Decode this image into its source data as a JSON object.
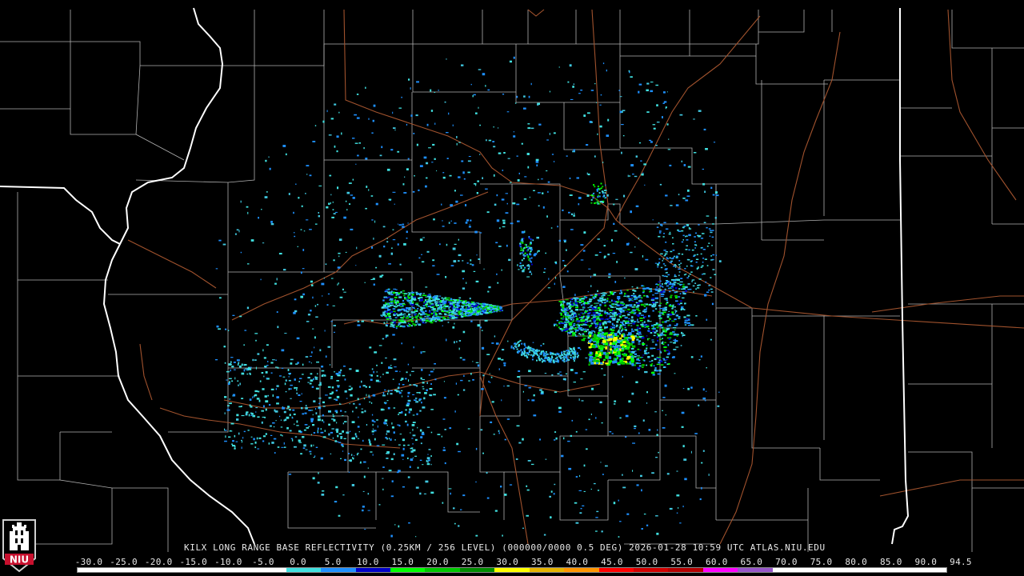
{
  "caption": "KILX LONG RANGE BASE REFLECTIVITY (0.25KM / 256 LEVEL) (000000/0000 0.5 DEG) 2026-01-28 10:59 UTC  ATLAS.NIU.EDU",
  "scale_labels": [
    "-30.0",
    "-25.0",
    "-20.0",
    "-15.0",
    "-10.0",
    "-5.0",
    "0.0",
    "5.0",
    "10.0",
    "15.0",
    "20.0",
    "25.0",
    "30.0",
    "35.0",
    "40.0",
    "45.0",
    "50.0",
    "55.0",
    "60.0",
    "65.0",
    "70.0",
    "75.0",
    "80.0",
    "85.0",
    "90.0",
    "94.5"
  ],
  "colorbar_colors": [
    "#ffffff",
    "#ffffff",
    "#ffffff",
    "#ffffff",
    "#ffffff",
    "#ffffff",
    "#40e0e0",
    "#1e90ff",
    "#0000c8",
    "#00ff00",
    "#00c800",
    "#008c00",
    "#ffff00",
    "#e6b400",
    "#ff9600",
    "#ff0000",
    "#d20000",
    "#b40000",
    "#ff00ff",
    "#9655c8",
    "#ffffff",
    "#ffffff",
    "#ffffff",
    "#ffffff",
    "#ffffff"
  ],
  "logo": {
    "text": "NIU"
  },
  "colors": {
    "background": "#000000",
    "county_lines": "#b4b4b4",
    "state_lines": "#ffffff",
    "roads": "#a0522d"
  }
}
